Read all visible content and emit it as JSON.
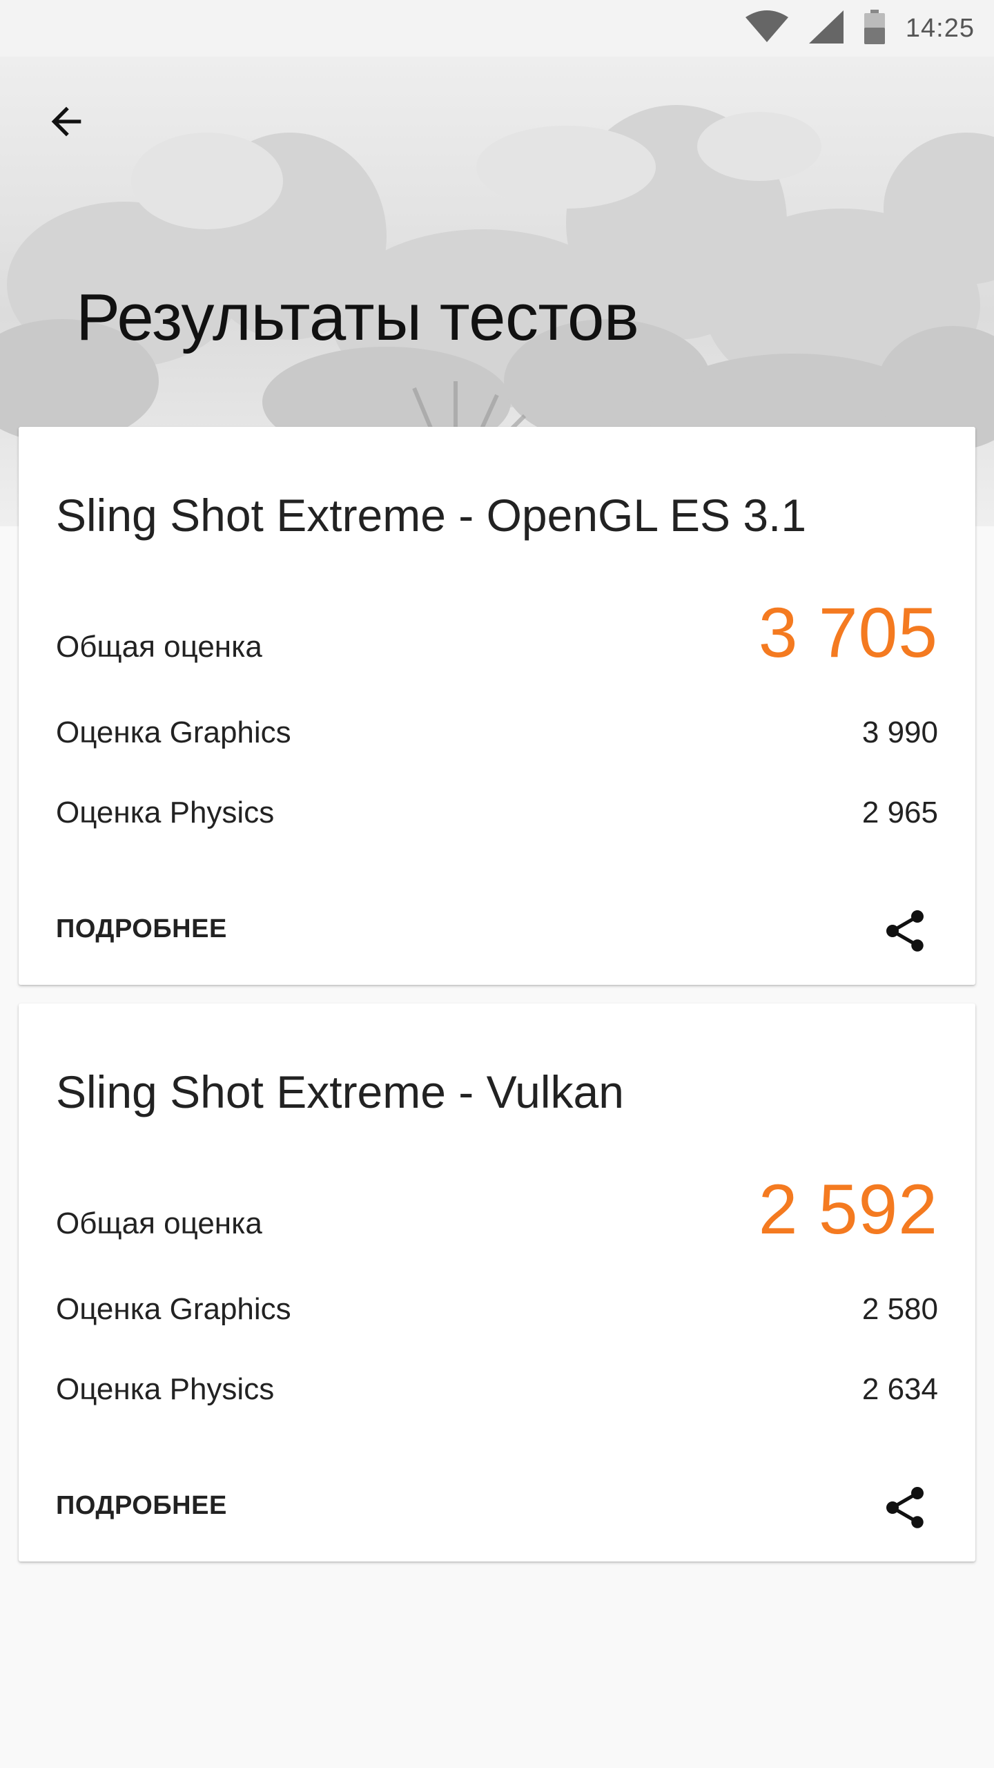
{
  "status_bar": {
    "time": "14:25",
    "icons": [
      "wifi-icon",
      "signal-icon",
      "battery-icon"
    ]
  },
  "header": {
    "back_icon": "arrow-left-icon",
    "title": "Результаты тестов"
  },
  "colors": {
    "accent": "#f47a20",
    "text": "#222222",
    "background": "#f9f9f9"
  },
  "results": [
    {
      "title": "Sling Shot Extreme - OpenGL ES 3.1",
      "total_label": "Общая оценка",
      "total_value": "3 705",
      "graphics_label": "Оценка Graphics",
      "graphics_value": "3 990",
      "physics_label": "Оценка Physics",
      "physics_value": "2 965",
      "more_label": "ПОДРОБНЕЕ",
      "share_icon": "share-icon"
    },
    {
      "title": "Sling Shot Extreme - Vulkan",
      "total_label": "Общая оценка",
      "total_value": "2 592",
      "graphics_label": "Оценка Graphics",
      "graphics_value": "2 580",
      "physics_label": "Оценка Physics",
      "physics_value": "2 634",
      "more_label": "ПОДРОБНЕЕ",
      "share_icon": "share-icon"
    }
  ]
}
